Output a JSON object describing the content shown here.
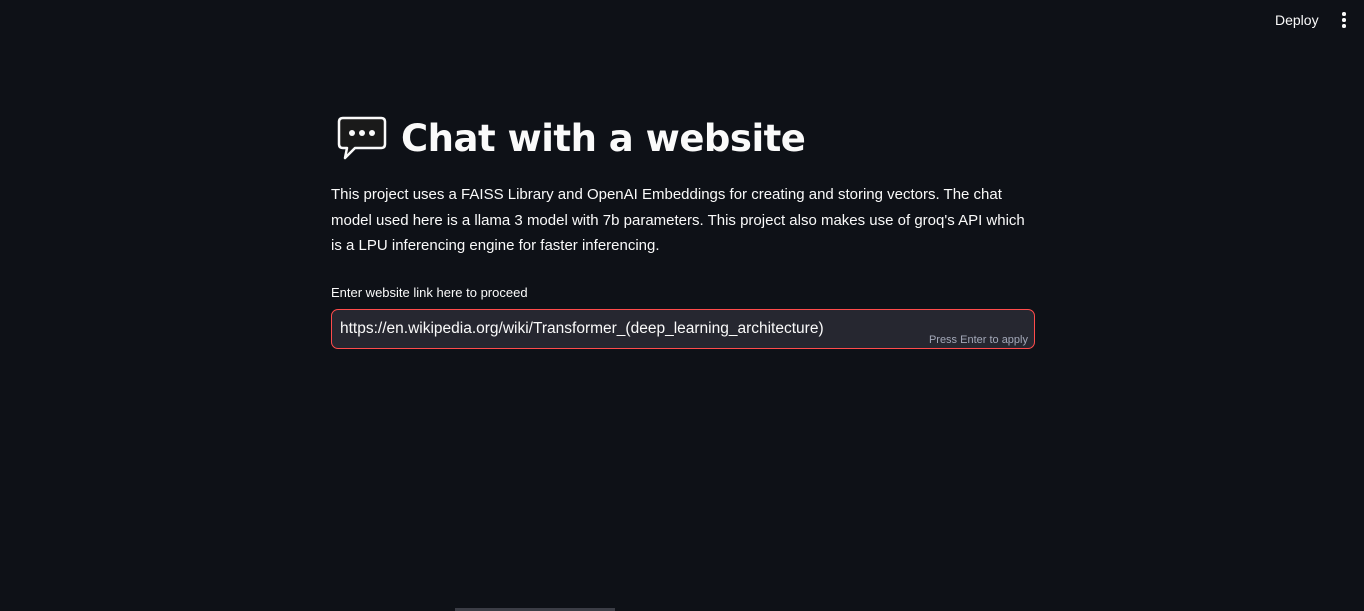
{
  "header": {
    "deploy_label": "Deploy",
    "menu_icon": "kebab-menu-icon"
  },
  "main": {
    "title_icon": "speech-bubble-icon",
    "title": "Chat with a website",
    "description": "This project uses a FAISS Library and OpenAI Embeddings for creating and storing vectors. The chat model used here is a llama 3 model with 7b parameters. This project also makes use of groq's API which is a LPU inferencing engine for faster inferencing.",
    "url_field": {
      "label": "Enter website link here to proceed",
      "value": "https://en.wikipedia.org/wiki/Transformer_(deep_learning_architecture)",
      "hint": "Press Enter to apply"
    }
  },
  "colors": {
    "background": "#0e1117",
    "input_background": "#262730",
    "focus_border": "#ff4b4b",
    "text": "#fafafa"
  }
}
